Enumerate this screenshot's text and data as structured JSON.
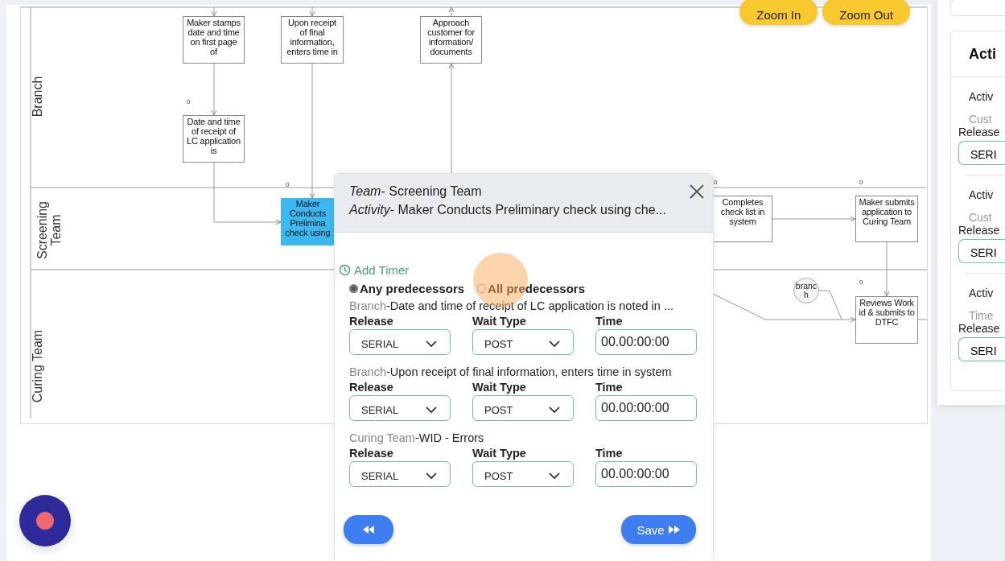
{
  "diagram": {
    "lanes": [
      {
        "name": "Branch"
      },
      {
        "name": "Screening Team"
      },
      {
        "name": "Curing Team"
      }
    ],
    "nodes": [
      {
        "text": "Maker stamps date and time on first page of",
        "selected": false
      },
      {
        "text": "Upon receipt of final information, enters time in",
        "selected": false
      },
      {
        "text": "Approach customer for information/ documents",
        "selected": false
      },
      {
        "text": "Date and time of receipt of LC application is",
        "selected": false
      },
      {
        "text": "Maker Conducts Prelimina check using",
        "selected": true
      },
      {
        "text": "Completes check list in system",
        "selected": false
      },
      {
        "text": "Maker submits application to Curing Team",
        "selected": false
      },
      {
        "text": "Reviews Work id & submits to DTFC",
        "selected": false
      }
    ],
    "gateway": "branch",
    "counts": [
      "0",
      "0",
      "0",
      "0",
      "0"
    ]
  },
  "zoom_buttons": [
    "Zoom In",
    "Zoom Out"
  ],
  "dialog": {
    "header_lines": [
      "*Team*- Screening Team",
      "*Activity*- Maker Conducts Preliminary check using che..."
    ],
    "add_timer": "Add Timer",
    "modes": [
      {
        "label": "Any predecessors",
        "selected": true
      },
      {
        "label": "All predecessors",
        "selected": false
      }
    ],
    "predecessors": [
      {
        "team": "Branch",
        "activity": "-Date and time of receipt of LC application is noted in ...",
        "fields": [
          {
            "kind": "select",
            "label": "Release",
            "value": "SERIAL"
          },
          {
            "kind": "select",
            "label": "Wait Type",
            "value": "POST"
          },
          {
            "kind": "input",
            "label": "Time",
            "value": "00.00:00:00"
          }
        ]
      },
      {
        "team": "Branch",
        "activity": "-Upon receipt of final information, enters time in system",
        "fields": [
          {
            "kind": "select",
            "label": "Release",
            "value": "SERIAL"
          },
          {
            "kind": "select",
            "label": "Wait Type",
            "value": "POST"
          },
          {
            "kind": "input",
            "label": "Time",
            "value": "00.00:00:00"
          }
        ]
      },
      {
        "team": "Curing Team",
        "activity": "-WID - Errors",
        "fields": [
          {
            "kind": "select",
            "label": "Release",
            "value": "SERIAL"
          },
          {
            "kind": "select",
            "label": "Wait Type",
            "value": "POST"
          },
          {
            "kind": "input",
            "label": "Time",
            "value": "00.00:00:00"
          }
        ]
      }
    ],
    "buttons": [
      {
        "kind": "back"
      },
      {
        "kind": "save",
        "label": "Save"
      }
    ]
  },
  "side_panel": {
    "title": "Acti",
    "groups": [
      {
        "heading": "Activ",
        "subtitle": "Cust",
        "label": "Release",
        "value": "SERI"
      },
      {
        "heading": "Activ",
        "subtitle": "Cust",
        "label": "Release",
        "value": "SERI"
      },
      {
        "heading": "Activ",
        "subtitle": "Time",
        "label": "Release",
        "value": "SERI"
      }
    ]
  }
}
